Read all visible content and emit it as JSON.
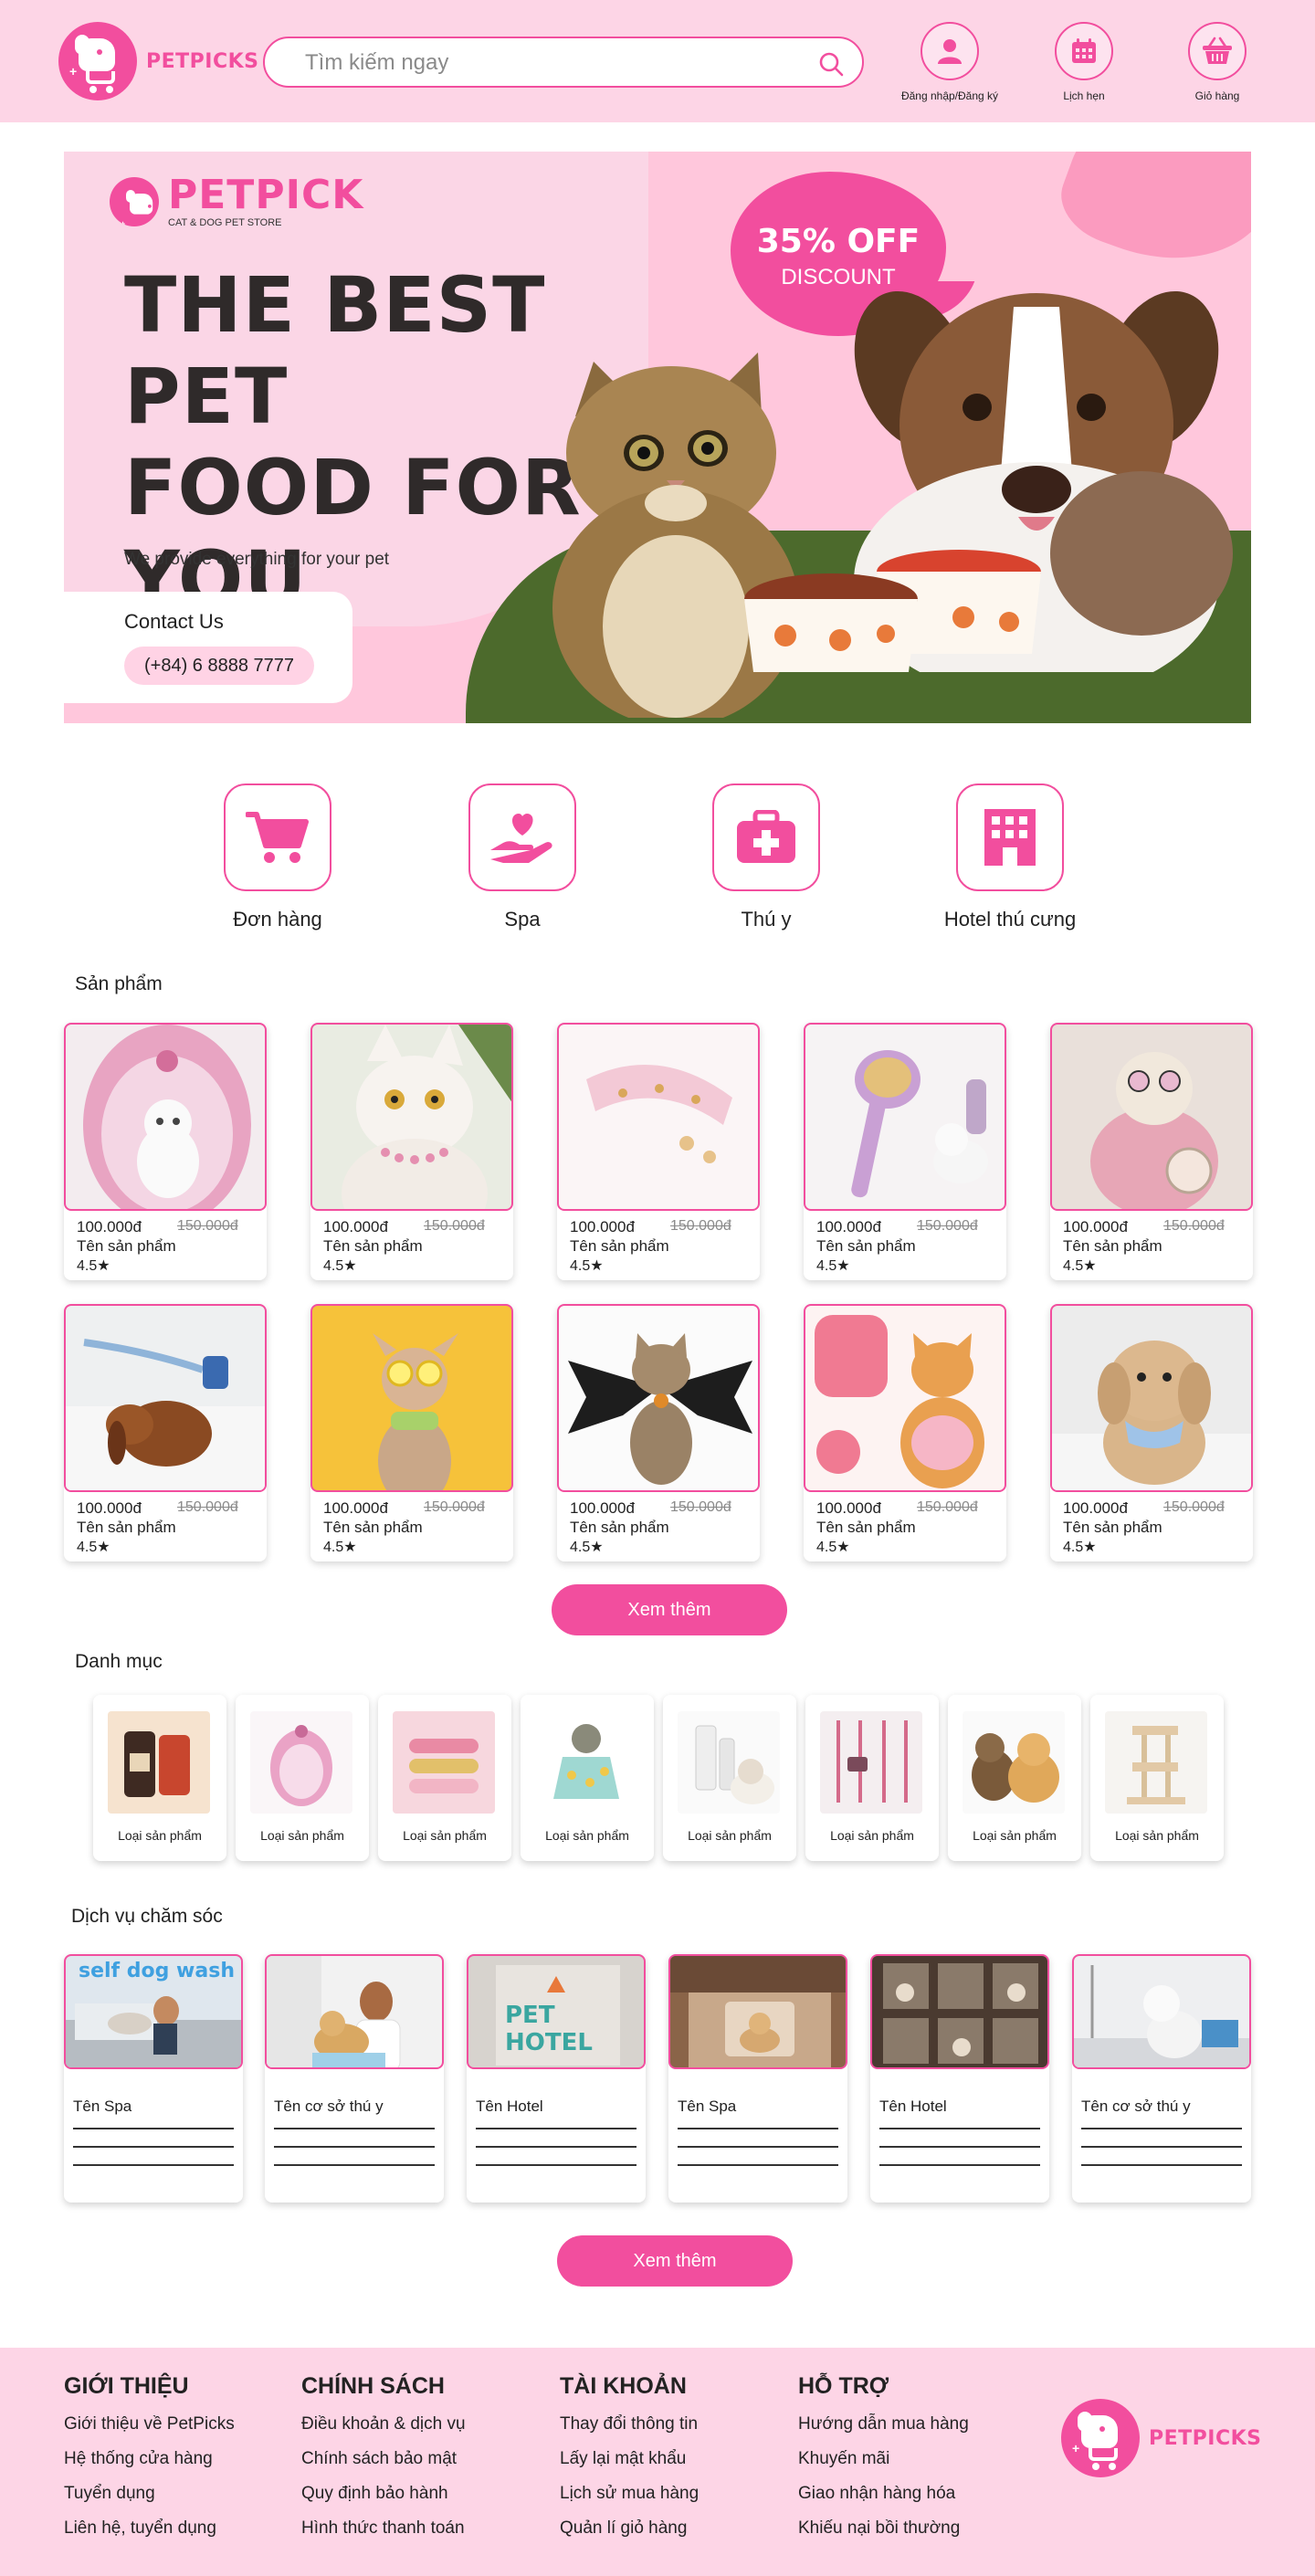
{
  "header": {
    "brand": "PETPICKS",
    "search_placeholder": "Tìm kiếm ngay",
    "actions": [
      {
        "label": "Đăng nhập/Đăng ký",
        "icon": "user-icon"
      },
      {
        "label": "Lịch hẹn",
        "icon": "calendar-icon"
      },
      {
        "label": "Giỏ hàng",
        "icon": "basket-icon"
      }
    ]
  },
  "banner": {
    "brand": "PETPICK",
    "tagline": "CAT & DOG PET STORE",
    "headline_lines": [
      "THE BEST PET",
      "FOOD FOR",
      "YOU"
    ],
    "subline": "We provide everything for your pet",
    "contact_title": "Contact Us",
    "phone": "(+84) 6 8888 7777",
    "promo_big": "35% OFF",
    "promo_small": "DISCOUNT"
  },
  "quick_services": [
    {
      "label": "Đơn hàng",
      "icon": "cart-icon"
    },
    {
      "label": "Spa",
      "icon": "hand-heart-icon"
    },
    {
      "label": "Thú y",
      "icon": "medical-kit-icon"
    },
    {
      "label": "Hotel thú cưng",
      "icon": "building-icon"
    }
  ],
  "products": {
    "title": "Sản phẩm",
    "items": [
      {
        "price": "100.000đ",
        "old_price": "150.000đ",
        "name": "Tên sản phẩm",
        "rating": "4.5★"
      },
      {
        "price": "100.000đ",
        "old_price": "150.000đ",
        "name": "Tên sản phẩm",
        "rating": "4.5★"
      },
      {
        "price": "100.000đ",
        "old_price": "150.000đ",
        "name": "Tên sản phẩm",
        "rating": "4.5★"
      },
      {
        "price": "100.000đ",
        "old_price": "150.000đ",
        "name": "Tên sản phẩm",
        "rating": "4.5★"
      },
      {
        "price": "100.000đ",
        "old_price": "150.000đ",
        "name": "Tên sản phẩm",
        "rating": "4.5★"
      },
      {
        "price": "100.000đ",
        "old_price": "150.000đ",
        "name": "Tên sản phẩm",
        "rating": "4.5★"
      },
      {
        "price": "100.000đ",
        "old_price": "150.000đ",
        "name": "Tên sản phẩm",
        "rating": "4.5★"
      },
      {
        "price": "100.000đ",
        "old_price": "150.000đ",
        "name": "Tên sản phẩm",
        "rating": "4.5★"
      },
      {
        "price": "100.000đ",
        "old_price": "150.000đ",
        "name": "Tên sản phẩm",
        "rating": "4.5★"
      },
      {
        "price": "100.000đ",
        "old_price": "150.000đ",
        "name": "Tên sản phẩm",
        "rating": "4.5★"
      }
    ],
    "more_label": "Xem thêm"
  },
  "categories": {
    "title": "Danh mục",
    "items": [
      {
        "label": "Loại sản phẩm"
      },
      {
        "label": "Loại sản phẩm"
      },
      {
        "label": "Loại sản phẩm"
      },
      {
        "label": "Loại sản phẩm"
      },
      {
        "label": "Loại sản phẩm"
      },
      {
        "label": "Loại sản phẩm"
      },
      {
        "label": "Loại sản phẩm"
      },
      {
        "label": "Loại sản phẩm"
      }
    ]
  },
  "services": {
    "title": "Dịch vụ chăm sóc",
    "items": [
      {
        "name": "Tên Spa",
        "image_text": "self dog wash"
      },
      {
        "name": "Tên cơ sở thú y",
        "image_text": ""
      },
      {
        "name": "Tên Hotel",
        "image_text": "PET HOTEL"
      },
      {
        "name": "Tên Spa",
        "image_text": ""
      },
      {
        "name": "Tên Hotel",
        "image_text": ""
      },
      {
        "name": "Tên cơ sở thú y",
        "image_text": ""
      }
    ],
    "more_label": "Xem thêm"
  },
  "footer": {
    "columns": [
      {
        "heading": "GIỚI THIỆU",
        "items": [
          "Giới thiệu về PetPicks",
          "Hệ thống cửa hàng",
          "Tuyển dụng",
          "Liên hệ, tuyển dụng"
        ]
      },
      {
        "heading": "CHÍNH SÁCH",
        "items": [
          "Điều khoản & dịch vụ",
          "Chính sách bảo mật",
          "Quy định bảo hành",
          "Hình thức thanh toán"
        ]
      },
      {
        "heading": "TÀI KHOẢN",
        "items": [
          "Thay đổi thông tin",
          "Lấy lại mật khẩu",
          "Lịch sử mua hàng",
          "Quản lí giỏ hàng"
        ]
      },
      {
        "heading": "HỖ TRỢ",
        "items": [
          "Hướng dẫn mua hàng",
          "Khuyến mãi",
          "Giao nhận hàng hóa",
          "Khiếu nại bồi thường"
        ]
      }
    ],
    "brand": "PETPICKS"
  },
  "colors": {
    "accent": "#f24e9e",
    "header_bg": "#fdd5e6",
    "banner_bg": "#ffc7dc",
    "banner_green": "#4c6a2c"
  }
}
